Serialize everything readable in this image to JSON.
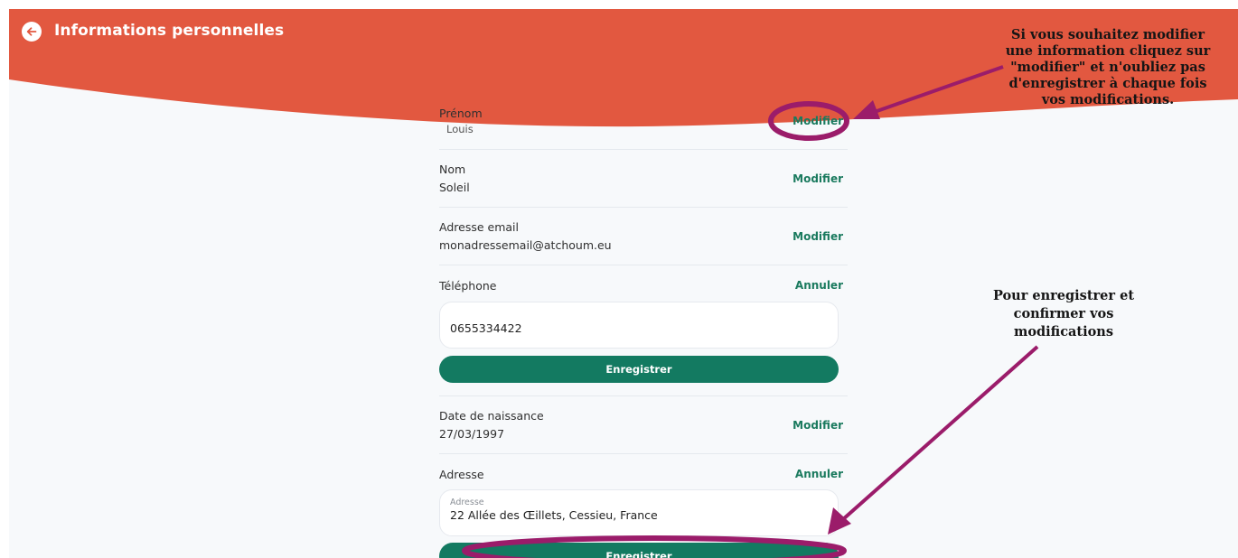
{
  "header": {
    "title": "Informations personnelles",
    "back_icon": "arrow-left-circle-icon",
    "color": "#e25840"
  },
  "fields": {
    "prenom": {
      "label": "Prénom",
      "value": "Louis",
      "action": "Modifier"
    },
    "nom": {
      "label": "Nom",
      "value": "Soleil",
      "action": "Modifier"
    },
    "email": {
      "label": "Adresse email",
      "value": "monadressemail@atchoum.eu",
      "action": "Modifier"
    },
    "telephone": {
      "label": "Téléphone",
      "action": "Annuler",
      "input_value": "0655334422",
      "save_label": "Enregistrer"
    },
    "naissance": {
      "label": "Date de naissance",
      "value": "27/03/1997",
      "action": "Modifier"
    },
    "adresse": {
      "label": "Adresse",
      "action": "Annuler",
      "input_label": "Adresse",
      "input_value": "22 Allée des Œillets, Cessieu, France",
      "save_label": "Enregistrer"
    }
  },
  "annotations": {
    "top": {
      "line1": "Si vous souhaitez modifier",
      "line2": "une information cliquez sur",
      "line3": "\"modifier\" et n'oubliez pas",
      "line4": "d'enregistrer à chaque fois",
      "line5": "vos modifications."
    },
    "middle": {
      "line1": "Pour enregistrer et",
      "line2": "confirmer vos",
      "line3": "modifications"
    },
    "color": "#9b1c6a"
  },
  "colors": {
    "accent_green": "#137a61",
    "link_green": "#1a7a5e",
    "header_red": "#e25840"
  }
}
